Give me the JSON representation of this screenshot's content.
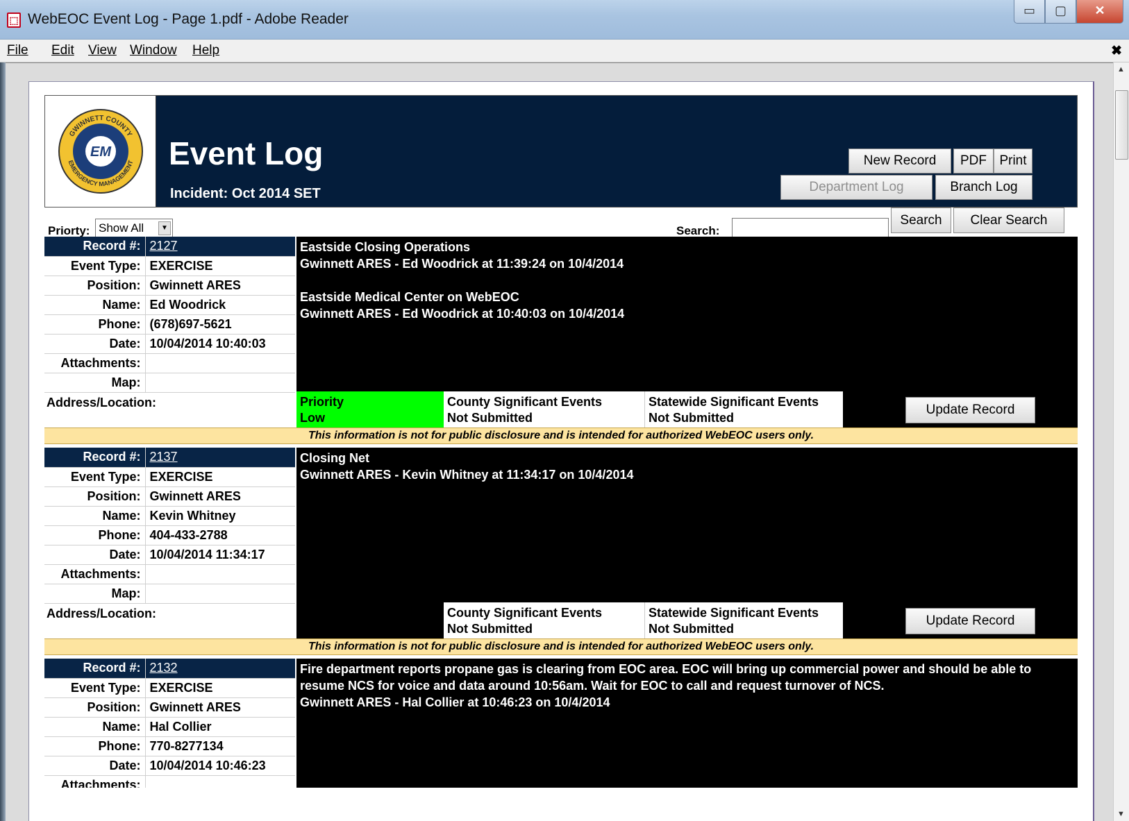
{
  "window": {
    "title": "WebEOC Event Log - Page 1.pdf - Adobe Reader"
  },
  "menu": {
    "file": "File",
    "edit": "Edit",
    "view": "View",
    "window": "Window",
    "help": "Help"
  },
  "header": {
    "logo_text_top": "GWINNETT COUNTY",
    "logo_text_center": "EM",
    "logo_text_bottom": "EMERGENCY MANAGEMENT",
    "title": "Event Log",
    "incident": "Incident: Oct 2014 SET",
    "new_record": "New Record",
    "pdf": "PDF",
    "print": "Print",
    "department_log": "Department Log",
    "branch_log": "Branch Log"
  },
  "toolbar": {
    "priority_label": "Priorty:",
    "priority_value": "Show All",
    "search_label": "Search:",
    "search_value": "",
    "search_button": "Search",
    "clear_search": "Clear Search"
  },
  "labels": {
    "record": "Record #:",
    "event_type": "Event Type:",
    "position": "Position:",
    "name": "Name:",
    "phone": "Phone:",
    "date": "Date:",
    "attachments": "Attachments:",
    "map": "Map:",
    "address": "Address/Location:",
    "county": "County Significant Events",
    "statewide": "Statewide Significant Events",
    "update": "Update Record",
    "disclaimer": "This information is not for public disclosure and is intended for authorized WebEOC users only."
  },
  "records": [
    {
      "record": "2127",
      "event_type": "EXERCISE",
      "position": "Gwinnett ARES",
      "name": "Ed Woodrick",
      "phone": "(678)697-5621",
      "date": "10/04/2014 10:40:03",
      "entries": [
        {
          "text": "Eastside Closing Operations",
          "meta": "Gwinnett ARES - Ed Woodrick at 11:39:24 on 10/4/2014"
        },
        {
          "text": "Eastside Medical Center on WebEOC",
          "meta": "Gwinnett ARES - Ed Woodrick at 10:40:03 on 10/4/2014"
        }
      ],
      "priority_label": "Priority",
      "priority_value": "Low",
      "county_status": "Not Submitted",
      "statewide_status": "Not Submitted"
    },
    {
      "record": "2137",
      "event_type": "EXERCISE",
      "position": "Gwinnett ARES",
      "name": "Kevin Whitney",
      "phone": "404-433-2788",
      "date": "10/04/2014 11:34:17",
      "entries": [
        {
          "text": "Closing Net",
          "meta": "Gwinnett ARES - Kevin Whitney at 11:34:17 on 10/4/2014"
        }
      ],
      "county_status": "Not Submitted",
      "statewide_status": "Not Submitted"
    },
    {
      "record": "2132",
      "event_type": "EXERCISE",
      "position": "Gwinnett ARES",
      "name": "Hal Collier",
      "phone": "770-8277134",
      "date": "10/04/2014 10:46:23",
      "entries": [
        {
          "text": "Fire department reports propane gas is clearing from EOC area. EOC will bring up commercial power and should be able to resume NCS for voice and data around 10:56am. Wait for EOC to call and request turnover of NCS.",
          "meta": "Gwinnett ARES - Hal Collier at 10:46:23 on 10/4/2014"
        }
      ]
    }
  ]
}
